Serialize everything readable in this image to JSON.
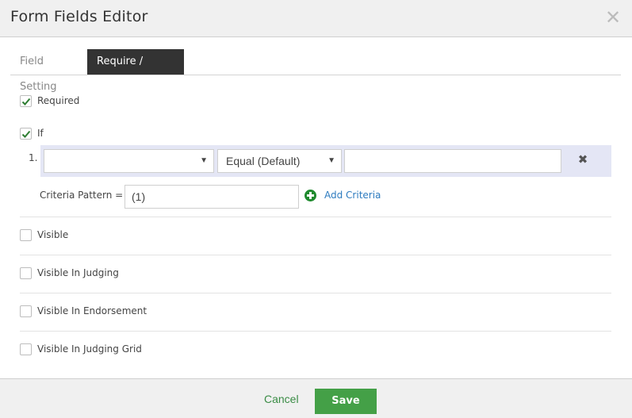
{
  "dialog": {
    "title": "Form Fields Editor",
    "close_glyph": "✕"
  },
  "tabs": [
    {
      "label": "Field Setting",
      "active": false
    },
    {
      "label": "Require / Visible",
      "active": true
    }
  ],
  "required": {
    "label": "Required",
    "checked": true
  },
  "if": {
    "label": "If",
    "checked": true
  },
  "criteria": {
    "rows": [
      {
        "index": "1.",
        "field_value": "",
        "operator_value": "Equal (Default)",
        "value": ""
      }
    ],
    "pattern_label": "Criteria Pattern =",
    "pattern_value": "(1)",
    "add_label": "Add Criteria",
    "add_icon_color": "#1f8a2e",
    "link_color": "#2d7bbf"
  },
  "visibility": [
    {
      "label": "Visible",
      "checked": false
    },
    {
      "label": "Visible In Judging",
      "checked": false
    },
    {
      "label": "Visible In Endorsement",
      "checked": false
    },
    {
      "label": "Visible In Judging Grid",
      "checked": false
    }
  ],
  "footer": {
    "cancel_label": "Cancel",
    "save_label": "Save",
    "save_color": "#44a047"
  },
  "icons": {
    "close": "close-icon",
    "check": "checkmark-icon",
    "arrow": "chevron-down-icon",
    "remove": "remove-icon",
    "add": "plus-circle-icon"
  }
}
